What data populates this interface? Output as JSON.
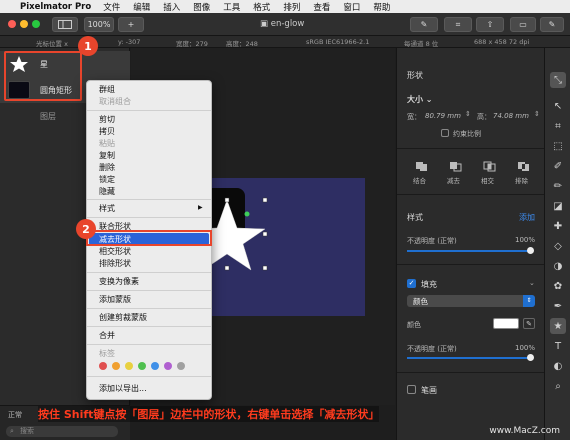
{
  "menubar": {
    "apple": "",
    "app_name": "Pixelmator Pro",
    "items": [
      "文件",
      "编辑",
      "插入",
      "图像",
      "工具",
      "格式",
      "排列",
      "查看",
      "窗口",
      "帮助"
    ]
  },
  "toolbar": {
    "zoom": "100%",
    "add_label": "+",
    "doc_title": "en-glow"
  },
  "infobar": {
    "cursor_label": "光标位置 x",
    "y_value": "y: -307",
    "width": "宽度：279",
    "height": "高度：248",
    "color_profile": "sRGB IEC61966-2.1",
    "bit_depth": "每通道 8 位",
    "size_info": "688 x 458 72 dpi"
  },
  "layers": [
    {
      "name": "星",
      "thumb": "star"
    },
    {
      "name": "圆角矩形",
      "thumb": "rounded-rect"
    },
    {
      "name": "图层",
      "thumb": "none"
    }
  ],
  "layers_footer": {
    "blend": "正常",
    "search_placeholder": "搜索"
  },
  "context_menu": {
    "items": [
      {
        "label": "群组",
        "disabled": false
      },
      {
        "label": "取消组合",
        "disabled": true
      },
      {
        "label": "剪切",
        "disabled": false
      },
      {
        "label": "拷贝",
        "disabled": false
      },
      {
        "label": "粘贴",
        "disabled": true
      },
      {
        "label": "复制",
        "disabled": false
      },
      {
        "label": "删除",
        "disabled": false
      },
      {
        "label": "锁定",
        "disabled": false
      },
      {
        "label": "隐藏",
        "disabled": false
      },
      {
        "label": "样式",
        "disabled": false,
        "submenu": true
      },
      {
        "label": "联合形状",
        "disabled": false
      },
      {
        "label": "减去形状",
        "disabled": false,
        "selected": true
      },
      {
        "label": "相交形状",
        "disabled": false
      },
      {
        "label": "排除形状",
        "disabled": false
      },
      {
        "label": "变换为像素",
        "disabled": false
      },
      {
        "label": "添加蒙版",
        "disabled": false
      },
      {
        "label": "创建剪裁蒙版",
        "disabled": false
      },
      {
        "label": "合并",
        "disabled": false
      },
      {
        "label": "标签",
        "disabled": true
      },
      {
        "label": "添加以导出...",
        "disabled": false
      }
    ],
    "submenu_arrow": "▶",
    "tag_colors": [
      "#e05050",
      "#f0a030",
      "#e8d040",
      "#50c050",
      "#4090e8",
      "#b060d0",
      "#a0a0a0"
    ]
  },
  "badges": {
    "one": "1",
    "two": "2"
  },
  "right_panel": {
    "shape_header": "形状",
    "size_label": "大小",
    "width_label": "宽：",
    "width_value": "80.79 mm",
    "height_label": "高：",
    "height_value": "74.08 mm",
    "constrain_label": "约束比例",
    "boolean_ops": [
      "结合",
      "减去",
      "相交",
      "排除"
    ],
    "style_header": "样式",
    "style_add": "添加",
    "opacity_label": "不透明度 (正常)",
    "opacity_value": "100%",
    "fill_label": "填充",
    "fill_type": "颜色",
    "color_label": "颜色",
    "fill_opacity_label": "不透明度 (正常)",
    "fill_opacity_value": "100%",
    "stroke_label": "笔画",
    "accent": "#1f6fd0"
  },
  "tools": [
    "arrange-icon",
    "select-icon",
    "crop-icon",
    "selection-icon",
    "paint-icon",
    "brush-icon",
    "fill-icon",
    "retouch-icon",
    "eraser-icon",
    "color-adjust-icon",
    "effects-icon",
    "pen-icon",
    "shape-icon",
    "type-icon",
    "distort-icon",
    "zoom-icon"
  ],
  "caption": "按住 Shift键点按「图层」边栏中的形状，右键单击选择「减去形状」",
  "watermark": "www.MacZ.com"
}
